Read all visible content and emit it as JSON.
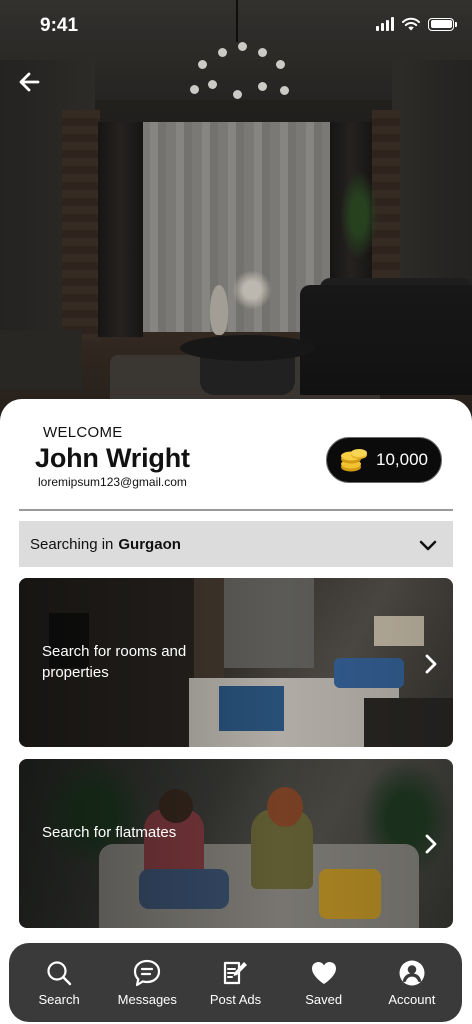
{
  "status_bar": {
    "time": "9:41"
  },
  "profile": {
    "welcome": "WELCOME",
    "name": "John Wright",
    "email": "loremipsum123@gmail.com",
    "coins": "10,000",
    "coin_icon": "coin-stack-icon",
    "coin_color": "#f2c230"
  },
  "location": {
    "prefix": "Searching in",
    "city": "Gurgaon"
  },
  "cards": [
    {
      "text": "Search for rooms and properties",
      "icon": "chevron-right-icon"
    },
    {
      "text": "Search for flatmates",
      "icon": "chevron-right-icon"
    }
  ],
  "bottom_nav": [
    {
      "label": "Search",
      "icon": "search-icon"
    },
    {
      "label": "Messages",
      "icon": "chat-bubble-icon"
    },
    {
      "label": "Post Ads",
      "icon": "edit-document-icon"
    },
    {
      "label": "Saved",
      "icon": "heart-icon"
    },
    {
      "label": "Account",
      "icon": "user-circle-icon"
    }
  ],
  "colors": {
    "sheet_bg": "#ffffff",
    "nav_bg": "#3a3a3a",
    "select_bg": "#dcdcdc",
    "badge_bg": "#0b0b0b"
  }
}
